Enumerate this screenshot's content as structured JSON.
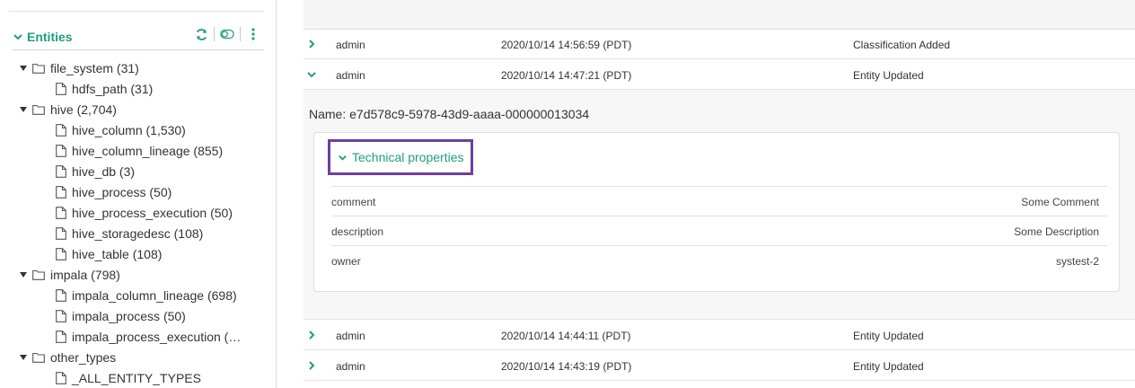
{
  "sidebar": {
    "title": "Entities",
    "tree": [
      {
        "label": "file_system (31)"
      },
      {
        "label": "hdfs_path (31)"
      },
      {
        "label": "hive (2,704)"
      },
      {
        "label": "hive_column (1,530)"
      },
      {
        "label": "hive_column_lineage (855)"
      },
      {
        "label": "hive_db (3)"
      },
      {
        "label": "hive_process (50)"
      },
      {
        "label": "hive_process_execution (50)"
      },
      {
        "label": "hive_storagedesc (108)"
      },
      {
        "label": "hive_table (108)"
      },
      {
        "label": "impala (798)"
      },
      {
        "label": "impala_column_lineage (698)"
      },
      {
        "label": "impala_process (50)"
      },
      {
        "label": "impala_process_execution (…"
      },
      {
        "label": "other_types"
      },
      {
        "label": "_ALL_ENTITY_TYPES"
      }
    ]
  },
  "audit": {
    "rows": [
      {
        "user": "admin",
        "time": "2020/10/14 14:56:59 (PDT)",
        "action": "Classification Added"
      },
      {
        "user": "admin",
        "time": "2020/10/14 14:47:21 (PDT)",
        "action": "Entity Updated"
      },
      {
        "user": "admin",
        "time": "2020/10/14 14:44:11 (PDT)",
        "action": "Entity Updated"
      },
      {
        "user": "admin",
        "time": "2020/10/14 14:43:19 (PDT)",
        "action": "Entity Updated"
      }
    ],
    "detail": {
      "name": "Name: e7d578c9-5978-43d9-aaaa-000000013034",
      "section_title": "Technical properties",
      "properties": [
        {
          "key": "comment",
          "value": "Some Comment"
        },
        {
          "key": "description",
          "value": "Some Description"
        },
        {
          "key": "owner",
          "value": "systest-2"
        }
      ]
    }
  },
  "colors": {
    "accent": "#1f9e80",
    "highlight_border": "#6b3fa0"
  }
}
